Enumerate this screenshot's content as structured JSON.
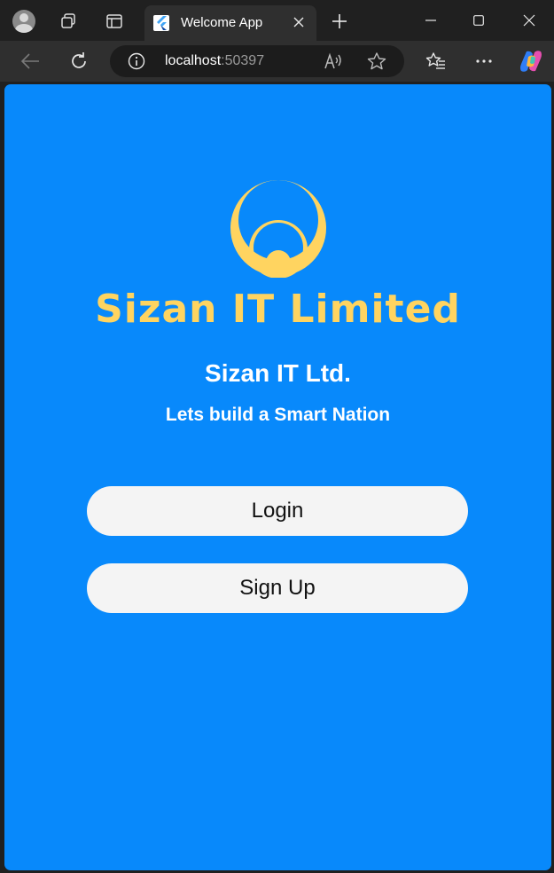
{
  "browser": {
    "tab_title": "Welcome App",
    "url_host": "localhost",
    "url_port": ":50397",
    "icons": {
      "profile": "profile-icon",
      "workspaces": "workspaces-icon",
      "tab_actions": "tab-actions-icon",
      "favicon": "flutter-favicon",
      "tab_close": "close-icon",
      "new_tab": "plus-icon",
      "minimize": "minimize-icon",
      "maximize": "maximize-icon",
      "window_close": "close-icon",
      "back": "back-arrow-icon",
      "refresh": "refresh-icon",
      "site_info": "info-icon",
      "read_aloud": "read-aloud-icon",
      "add_favorite": "star-icon",
      "favorites": "favorites-icon",
      "more": "more-icon",
      "copilot": "copilot-icon"
    }
  },
  "app": {
    "logo_text": "Sizan IT Limited",
    "company_name": "Sizan IT Ltd.",
    "tagline": "Lets build a Smart Nation",
    "login_label": "Login",
    "signup_label": "Sign Up",
    "colors": {
      "background": "#0889fb",
      "logo": "#ffd460",
      "button": "#f4f4f4"
    }
  }
}
